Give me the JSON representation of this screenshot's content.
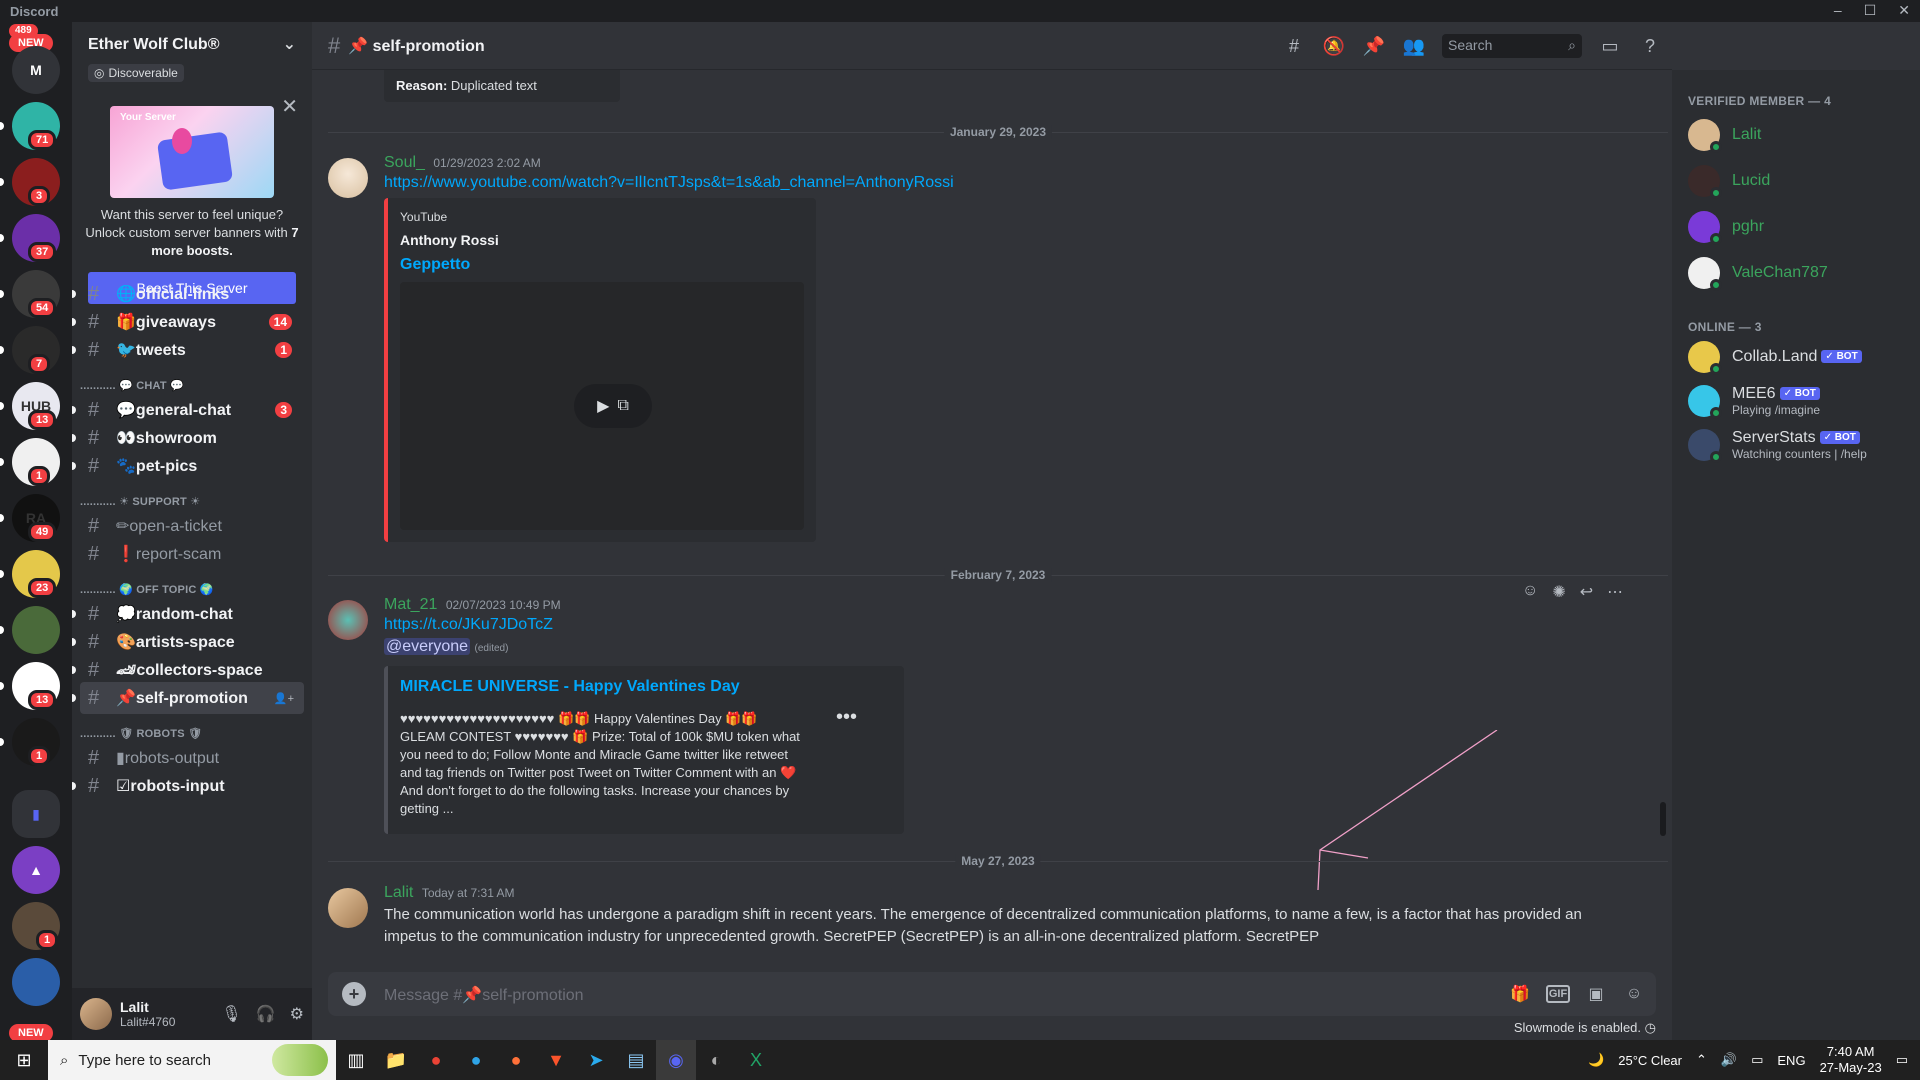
{
  "window": {
    "app_name": "Discord"
  },
  "guilds": {
    "top_badge": "489",
    "first_initial": "M",
    "items": [
      {
        "badge": "71",
        "color": "#2fb4a6"
      },
      {
        "badge": "3",
        "color": "#8b1e1e"
      },
      {
        "badge": "37",
        "color": "#6b2fa8"
      },
      {
        "badge": "54",
        "color": "#3a3a3a"
      },
      {
        "badge": "7",
        "color": "#2a2a2a"
      },
      {
        "badge": "13",
        "color": "#e8e8f0",
        "label": "HUB"
      },
      {
        "badge": "1",
        "color": "#f0f0f0"
      },
      {
        "badge": "49",
        "color": "#111111",
        "label": "RA"
      },
      {
        "badge": "23",
        "color": "#e4c84a"
      },
      {
        "badge": "",
        "color": "#4a6a3a"
      },
      {
        "badge": "13",
        "color": "#ffffff"
      },
      {
        "badge": "1",
        "color": "#1a1a1a"
      }
    ],
    "new_label": "NEW"
  },
  "server": {
    "name": "Ether Wolf Club®",
    "discoverable_label": "Discoverable",
    "boost": {
      "banner_label": "Your Server",
      "text_1": "Want this server to feel unique? Unlock custom server banners with",
      "text_bold": "7 more boosts.",
      "button": "Boost This Server"
    }
  },
  "channels": [
    {
      "name": "🌐official-links",
      "badge": "",
      "muted": false
    },
    {
      "name": "🎁giveaways",
      "badge": "14",
      "muted": false
    },
    {
      "name": "🐦tweets",
      "badge": "1",
      "muted": false
    },
    {
      "name": "💬general-chat",
      "badge": "3",
      "muted": false
    },
    {
      "name": "👀showroom",
      "badge": "",
      "muted": false
    },
    {
      "name": "🐾pet-pics",
      "badge": "",
      "muted": false
    },
    {
      "name": "✏open-a-ticket",
      "badge": "",
      "muted": true
    },
    {
      "name": "❗report-scam",
      "badge": "",
      "muted": true
    },
    {
      "name": "💭random-chat",
      "badge": "",
      "muted": false
    },
    {
      "name": "🎨artists-space",
      "badge": "",
      "muted": false
    },
    {
      "name": "🏎collectors-space",
      "badge": "",
      "muted": false
    },
    {
      "name": "📌self-promotion",
      "badge": "",
      "muted": false
    },
    {
      "name": "▮robots-output",
      "badge": "",
      "muted": true
    },
    {
      "name": "☑robots-input",
      "badge": "",
      "muted": false
    }
  ],
  "categories": {
    "chat": "........... 💬 CHAT 💬",
    "support": "........... ☀ SUPPORT ☀",
    "offtopic": "........... 🌍 OFF TOPIC 🌍",
    "robots": "........... 🛡 ROBOTS 🛡"
  },
  "user": {
    "name": "Lalit",
    "tag": "Lalit#4760"
  },
  "channel_header": {
    "title": "📌 self-promotion",
    "search_placeholder": "Search"
  },
  "messages": {
    "reason_label": "Reason:",
    "reason_text": "Duplicated text",
    "date_1": "January 29, 2023",
    "m1": {
      "author": "Soul_",
      "time": "01/29/2023 2:02 AM",
      "link": "https://www.youtube.com/watch?v=IlIcntTJsps&t=1s&ab_channel=AnthonyRossi",
      "embed_provider": "YouTube",
      "embed_author": "Anthony Rossi",
      "embed_title": "Geppetto"
    },
    "date_2": "February 7, 2023",
    "m2": {
      "author": "Mat_21",
      "time": "02/07/2023 10:49 PM",
      "link": "https://t.co/JKu7JDoTcZ",
      "mention": "@everyone",
      "edited": "(edited)",
      "embed_title": "MIRACLE UNIVERSE - Happy Valentines Day",
      "embed_desc": "♥♥♥♥♥♥♥♥♥♥♥♥♥♥♥♥♥♥♥♥ 🎁🎁 Happy Valentines Day 🎁🎁 GLEAM CONTEST ♥♥♥♥♥♥♥ 🎁 Prize: Total of 100k $MU token what you need to do; Follow Monte and Miracle Game twitter like retweet and tag friends on Twitter post Tweet on Twitter Comment with an ❤️ And don't forget to do the following tasks. Increase your chances by getting ..."
    },
    "date_3": "May 27, 2023",
    "m3": {
      "author": "Lalit",
      "time": "Today at 7:31 AM",
      "text": "The communication world has undergone a paradigm shift in recent years. The emergence of decentralized communication platforms, to name a few, is a factor that has provided an impetus to the communication industry for unprecedented growth. SecretPEP (SecretPEP) is an all-in-one decentralized platform. SecretPEP"
    }
  },
  "composer": {
    "placeholder": "Message #📌self-promotion",
    "slowmode": "Slowmode is enabled."
  },
  "members": {
    "verified_header": "VERIFIED MEMBER — 4",
    "verified": [
      {
        "name": "Lalit",
        "color": "#3ba55d"
      },
      {
        "name": "Lucid",
        "color": "#3ba55d"
      },
      {
        "name": "pghr",
        "color": "#3ba55d"
      },
      {
        "name": "ValeChan787",
        "color": "#3ba55d"
      }
    ],
    "online_header": "ONLINE — 3",
    "online": [
      {
        "name": "Collab.Land",
        "bot": "✓ BOT",
        "activity": ""
      },
      {
        "name": "MEE6",
        "bot": "✓ BOT",
        "activity": "Playing /imagine"
      },
      {
        "name": "ServerStats",
        "bot": "✓ BOT",
        "activity": "Watching counters | /help"
      }
    ]
  },
  "taskbar": {
    "search_placeholder": "Type here to search",
    "weather": "25°C  Clear",
    "lang": "ENG",
    "time": "7:40 AM",
    "date": "27-May-23"
  }
}
